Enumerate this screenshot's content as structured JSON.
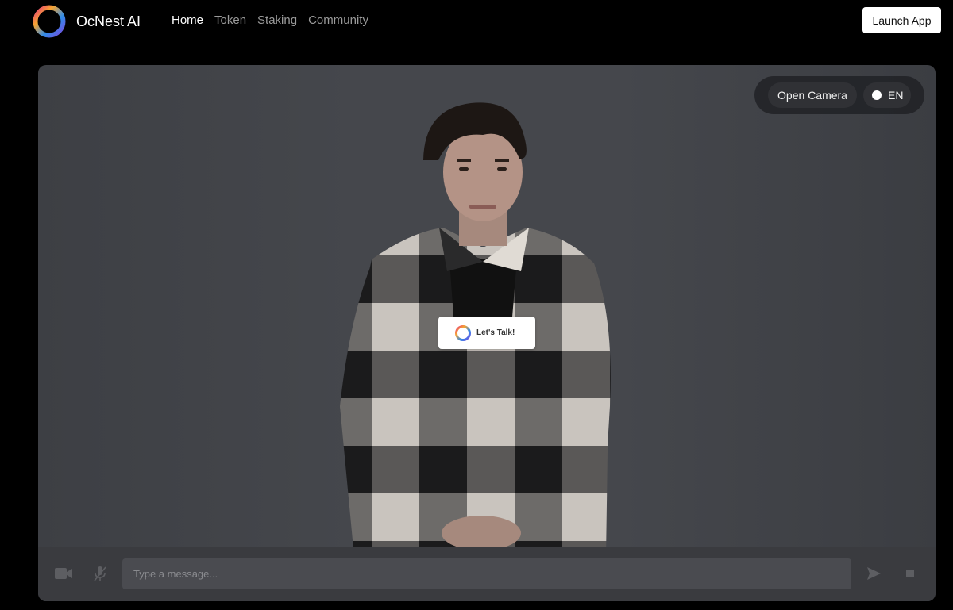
{
  "header": {
    "brand_name": "OcNest AI",
    "nav": [
      {
        "label": "Home",
        "active": true
      },
      {
        "label": "Token",
        "active": false
      },
      {
        "label": "Staking",
        "active": false
      },
      {
        "label": "Community",
        "active": false
      }
    ],
    "launch_label": "Launch App"
  },
  "stage": {
    "open_camera_label": "Open Camera",
    "language": "EN",
    "talk_label": "Let's Talk!",
    "message_placeholder": "Type a message...",
    "icons": [
      "video-camera-icon",
      "microphone-muted-icon",
      "send-icon",
      "stop-icon"
    ]
  },
  "colors": {
    "background": "#000000",
    "stage": "#45474c",
    "logo_gradient": [
      "#e8397a",
      "#f7a531",
      "#2f8be8",
      "#7b4be0"
    ]
  }
}
